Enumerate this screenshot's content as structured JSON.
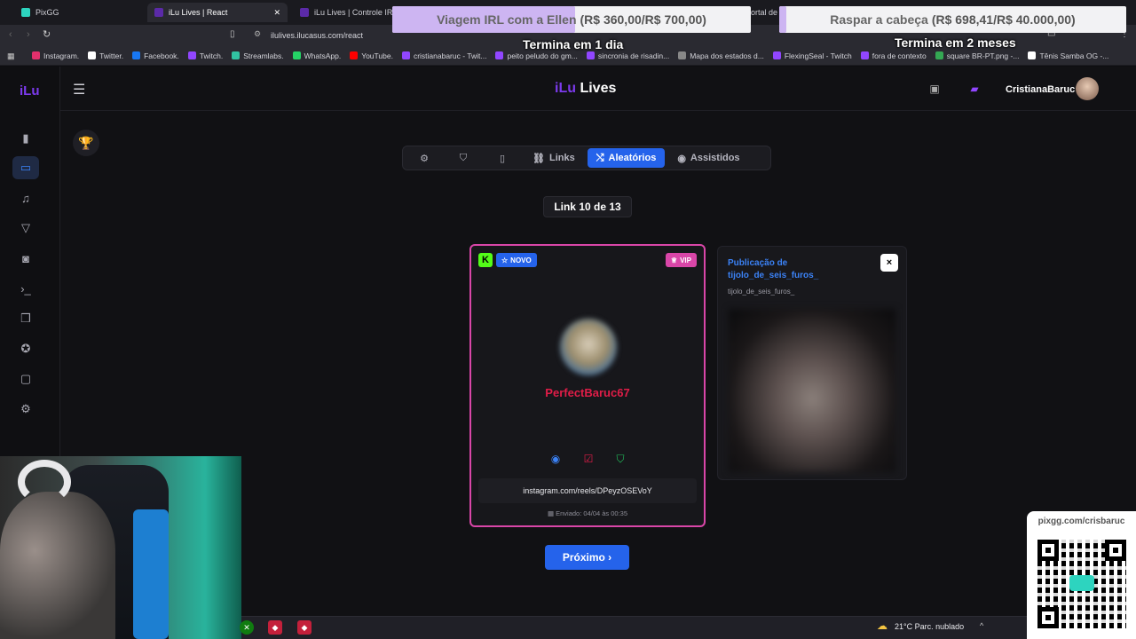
{
  "browser": {
    "tabs": [
      {
        "label": "PixGG"
      },
      {
        "label": "iLu Lives | React"
      },
      {
        "label": "iLu Lives | Controle IRL"
      },
      {
        "label": "ortal de a"
      }
    ],
    "url": "ilulives.ilucasus.com/react",
    "bookmarks": [
      {
        "label": "Instagram.",
        "color": "#e1306c"
      },
      {
        "label": "Twitter.",
        "color": "#ffffff"
      },
      {
        "label": "Facebook.",
        "color": "#1877f2"
      },
      {
        "label": "Twitch.",
        "color": "#9146ff"
      },
      {
        "label": "Streamlabs.",
        "color": "#31c3a2"
      },
      {
        "label": "WhatsApp.",
        "color": "#25d366"
      },
      {
        "label": "YouTube.",
        "color": "#ff0000"
      },
      {
        "label": "cristianabaruc - Twit...",
        "color": "#9146ff"
      },
      {
        "label": "peito peludo do gm...",
        "color": "#9146ff"
      },
      {
        "label": "sincronia de risadin...",
        "color": "#9146ff"
      },
      {
        "label": "Mapa dos estados d...",
        "color": "#888888"
      },
      {
        "label": "FlexingSeal - Twitch",
        "color": "#9146ff"
      },
      {
        "label": "fora de contexto",
        "color": "#9146ff"
      },
      {
        "label": "square BR-PT.png -...",
        "color": "#34a853"
      },
      {
        "label": "Tênis Samba OG -...",
        "color": "#ffffff"
      }
    ]
  },
  "overlays": {
    "goal1": {
      "title": "Viagem IRL com a Ellen",
      "amount": "(R$ 360,00/R$ 700,00)",
      "progress": 0.51,
      "subtitle": "Termina em 1 dia"
    },
    "goal2": {
      "title": "Raspar a cabeça",
      "amount": "(R$ 698,41/R$ 40.000,00)",
      "progress": 0.02,
      "subtitle": "Termina em 2 meses"
    },
    "qr_label": "pixgg.com/crisbaruc"
  },
  "app": {
    "logo": "iLu",
    "brand_a": "iLu",
    "brand_b": "Lives",
    "user_name": "CristianaBaruc",
    "tabs": {
      "links": "Links",
      "aleatorios": "Aleatórios",
      "assistidos": "Assistidos"
    },
    "counter": "Link 10 de 13",
    "card": {
      "badge_k": "K",
      "novo": "NOVO",
      "vip": "VIP",
      "name": "PerfectBaruc67",
      "link": "instagram.com/reels/DPeyzOSEVoY",
      "sent": "Enviado: 04/04 às 00:35"
    },
    "side_card": {
      "title": "Publicação de tijolo_de_seis_furos_",
      "subtitle": "tijolo_de_seis_furos_",
      "close": "×"
    },
    "next_button": "Próximo ›"
  },
  "taskbar": {
    "temp": "21°C",
    "weather": "Parc. nublado"
  }
}
